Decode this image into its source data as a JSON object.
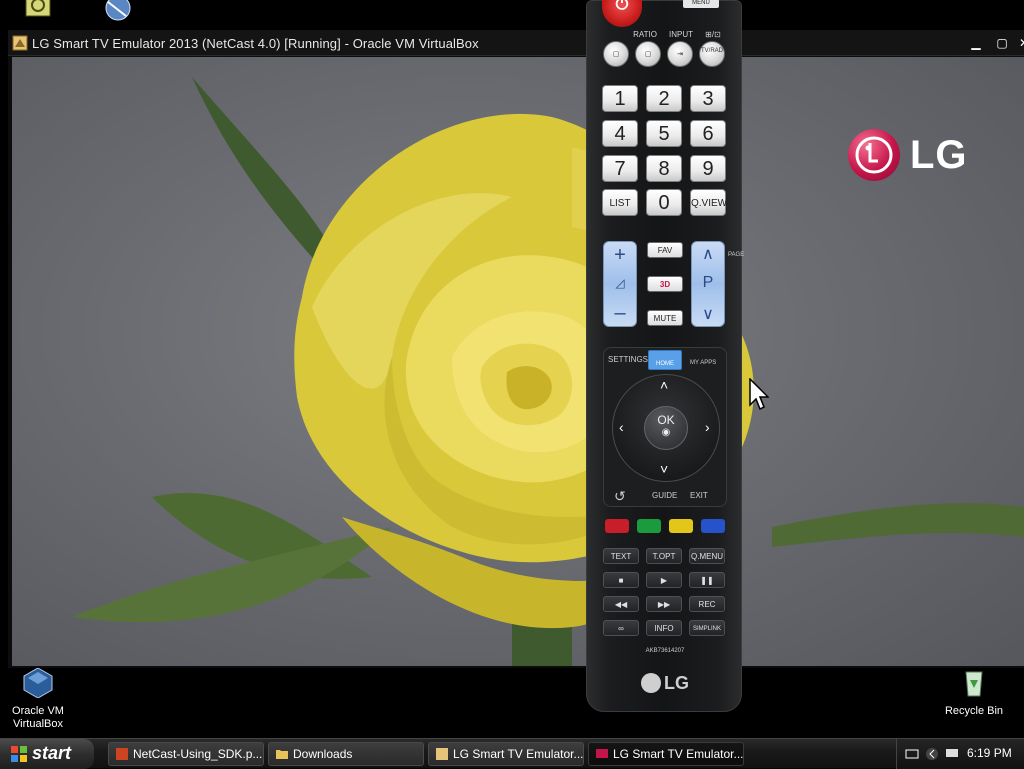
{
  "window": {
    "title": "LG Smart TV Emulator 2013 (NetCast 4.0) [Running] - Oracle VM VirtualBox",
    "controls": [
      "minimize",
      "maximize",
      "close"
    ]
  },
  "tv": {
    "brand": "LG",
    "background_image": "yellow-rose"
  },
  "remote": {
    "menu_label": "MENU",
    "labels": {
      "ratio": "RATIO",
      "input": "INPUT",
      "tvrad_top": "⊞/⊡"
    },
    "top_buttons": {
      "ratio_glyph": "▢",
      "input_glyph": "⇥",
      "tvrad": "TV/RAD",
      "q": "▢"
    },
    "numbers": [
      "1",
      "2",
      "3",
      "4",
      "5",
      "6",
      "7",
      "8",
      "9"
    ],
    "row4": {
      "list": "LIST",
      "zero": "0",
      "qview": "Q.VIEW"
    },
    "volume": {
      "plus": "+",
      "minus": "–"
    },
    "middle": {
      "fav": "FAV",
      "3d": "3D",
      "mute": "MUTE"
    },
    "channel": {
      "up": "∧",
      "p": "P",
      "down": "∨",
      "page": "PAGE"
    },
    "nav": {
      "settings": "SETTINGS",
      "home": "HOME",
      "my_apps": "MY APPS",
      "ok": "OK",
      "back": "↺",
      "guide": "GUIDE",
      "exit": "EXIT"
    },
    "colors": [
      "#c81e2a",
      "#1c9a3e",
      "#e3c61a",
      "#2653c9"
    ],
    "func_rows": [
      [
        "TEXT",
        "T.OPT",
        "Q.MENU"
      ],
      [
        "■",
        "▶",
        "❚❚"
      ],
      [
        "◀◀",
        "▶▶",
        "REC"
      ],
      [
        "∞",
        "INFO",
        "SIMPLINK"
      ]
    ],
    "model_code": "AKB73614207",
    "bottom_brand": "LG"
  },
  "desktop_icons": [
    {
      "label": "Oracle VM VirtualBox",
      "icon": "virtualbox-icon"
    },
    {
      "label": "Recycle Bin",
      "icon": "recycle-bin-icon"
    }
  ],
  "taskbar": {
    "start": "start",
    "tasks": [
      {
        "label": "NetCast-Using_SDK.p...",
        "icon": "pdf-icon"
      },
      {
        "label": "Downloads",
        "icon": "folder-icon"
      },
      {
        "label": "LG Smart TV Emulator...",
        "icon": "virtualbox-icon"
      },
      {
        "label": "LG Smart TV Emulator...",
        "icon": "emulator-icon"
      }
    ],
    "clock": "6:19 PM"
  }
}
